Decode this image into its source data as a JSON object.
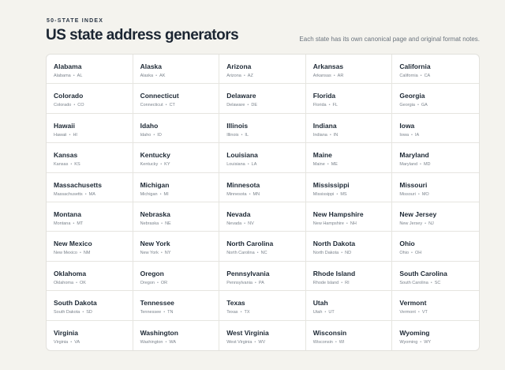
{
  "header": {
    "eyebrow": "50-STATE INDEX",
    "title": "US state address generators",
    "subtitle": "Each state has its own canonical page and original format notes."
  },
  "meta_separator": "•",
  "states": [
    {
      "name": "Alabama",
      "code": "AL"
    },
    {
      "name": "Alaska",
      "code": "AK"
    },
    {
      "name": "Arizona",
      "code": "AZ"
    },
    {
      "name": "Arkansas",
      "code": "AR"
    },
    {
      "name": "California",
      "code": "CA"
    },
    {
      "name": "Colorado",
      "code": "CO"
    },
    {
      "name": "Connecticut",
      "code": "CT"
    },
    {
      "name": "Delaware",
      "code": "DE"
    },
    {
      "name": "Florida",
      "code": "FL"
    },
    {
      "name": "Georgia",
      "code": "GA"
    },
    {
      "name": "Hawaii",
      "code": "HI"
    },
    {
      "name": "Idaho",
      "code": "ID"
    },
    {
      "name": "Illinois",
      "code": "IL"
    },
    {
      "name": "Indiana",
      "code": "IN"
    },
    {
      "name": "Iowa",
      "code": "IA"
    },
    {
      "name": "Kansas",
      "code": "KS"
    },
    {
      "name": "Kentucky",
      "code": "KY"
    },
    {
      "name": "Louisiana",
      "code": "LA"
    },
    {
      "name": "Maine",
      "code": "ME"
    },
    {
      "name": "Maryland",
      "code": "MD"
    },
    {
      "name": "Massachusetts",
      "code": "MA"
    },
    {
      "name": "Michigan",
      "code": "MI"
    },
    {
      "name": "Minnesota",
      "code": "MN"
    },
    {
      "name": "Mississippi",
      "code": "MS"
    },
    {
      "name": "Missouri",
      "code": "MO"
    },
    {
      "name": "Montana",
      "code": "MT"
    },
    {
      "name": "Nebraska",
      "code": "NE"
    },
    {
      "name": "Nevada",
      "code": "NV"
    },
    {
      "name": "New Hampshire",
      "code": "NH"
    },
    {
      "name": "New Jersey",
      "code": "NJ"
    },
    {
      "name": "New Mexico",
      "code": "NM"
    },
    {
      "name": "New York",
      "code": "NY"
    },
    {
      "name": "North Carolina",
      "code": "NC"
    },
    {
      "name": "North Dakota",
      "code": "ND"
    },
    {
      "name": "Ohio",
      "code": "OH"
    },
    {
      "name": "Oklahoma",
      "code": "OK"
    },
    {
      "name": "Oregon",
      "code": "OR"
    },
    {
      "name": "Pennsylvania",
      "code": "PA"
    },
    {
      "name": "Rhode Island",
      "code": "RI"
    },
    {
      "name": "South Carolina",
      "code": "SC"
    },
    {
      "name": "South Dakota",
      "code": "SD"
    },
    {
      "name": "Tennessee",
      "code": "TN"
    },
    {
      "name": "Texas",
      "code": "TX"
    },
    {
      "name": "Utah",
      "code": "UT"
    },
    {
      "name": "Vermont",
      "code": "VT"
    },
    {
      "name": "Virginia",
      "code": "VA"
    },
    {
      "name": "Washington",
      "code": "WA"
    },
    {
      "name": "West Virginia",
      "code": "WV"
    },
    {
      "name": "Wisconsin",
      "code": "WI"
    },
    {
      "name": "Wyoming",
      "code": "WY"
    }
  ]
}
